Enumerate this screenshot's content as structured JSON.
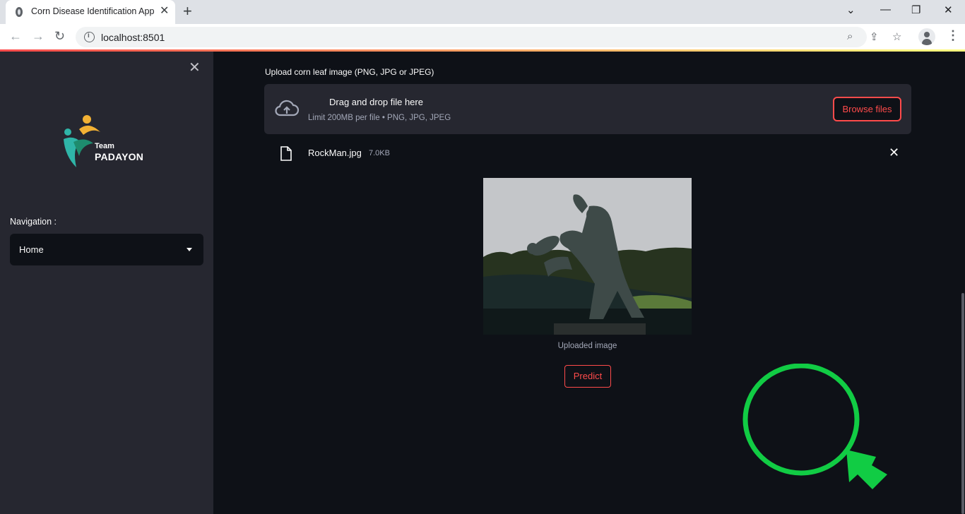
{
  "browser": {
    "tab_title": "Corn Disease Identification App",
    "url": "localhost:8501"
  },
  "sidebar": {
    "logo_text_top": "Team",
    "logo_text_bottom": "PADAYON",
    "nav_label": "Navigation :",
    "nav_selected": "Home"
  },
  "uploader": {
    "label": "Upload corn leaf image (PNG, JPG or JPEG)",
    "drop_title": "Drag and drop file here",
    "drop_subtitle": "Limit 200MB per file • PNG, JPG, JPEG",
    "browse_label": "Browse files",
    "file_name": "RockMan.jpg",
    "file_size": "7.0KB"
  },
  "image": {
    "caption": "Uploaded image"
  },
  "predict_label": "Predict",
  "colors": {
    "accent": "#ff4b4b",
    "annotation": "#11cc44",
    "sidebar_bg": "#262730",
    "main_bg": "#0e1117"
  }
}
